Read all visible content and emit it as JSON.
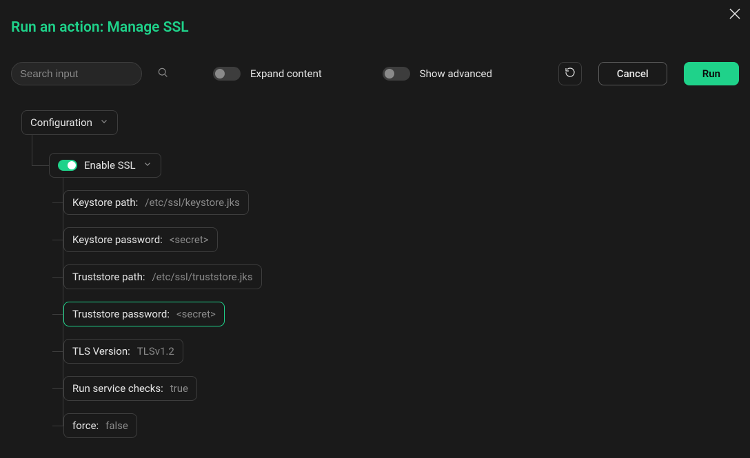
{
  "title": "Run an action: Manage SSL",
  "toolbar": {
    "search_placeholder": "Search input",
    "expand_label": "Expand content",
    "advanced_label": "Show advanced",
    "cancel_label": "Cancel",
    "run_label": "Run"
  },
  "tree": {
    "root_label": "Configuration",
    "enable_label": "Enable SSL",
    "fields": [
      {
        "label": "Keystore path:",
        "value": "/etc/ssl/keystore.jks",
        "selected": false
      },
      {
        "label": "Keystore password:",
        "value": "<secret>",
        "selected": false
      },
      {
        "label": "Truststore path:",
        "value": "/etc/ssl/truststore.jks",
        "selected": false
      },
      {
        "label": "Truststore password:",
        "value": "<secret>",
        "selected": true
      },
      {
        "label": "TLS Version:",
        "value": "TLSv1.2",
        "selected": false
      },
      {
        "label": "Run service checks:",
        "value": "true",
        "selected": false
      },
      {
        "label": "force:",
        "value": "false",
        "selected": false
      }
    ]
  }
}
